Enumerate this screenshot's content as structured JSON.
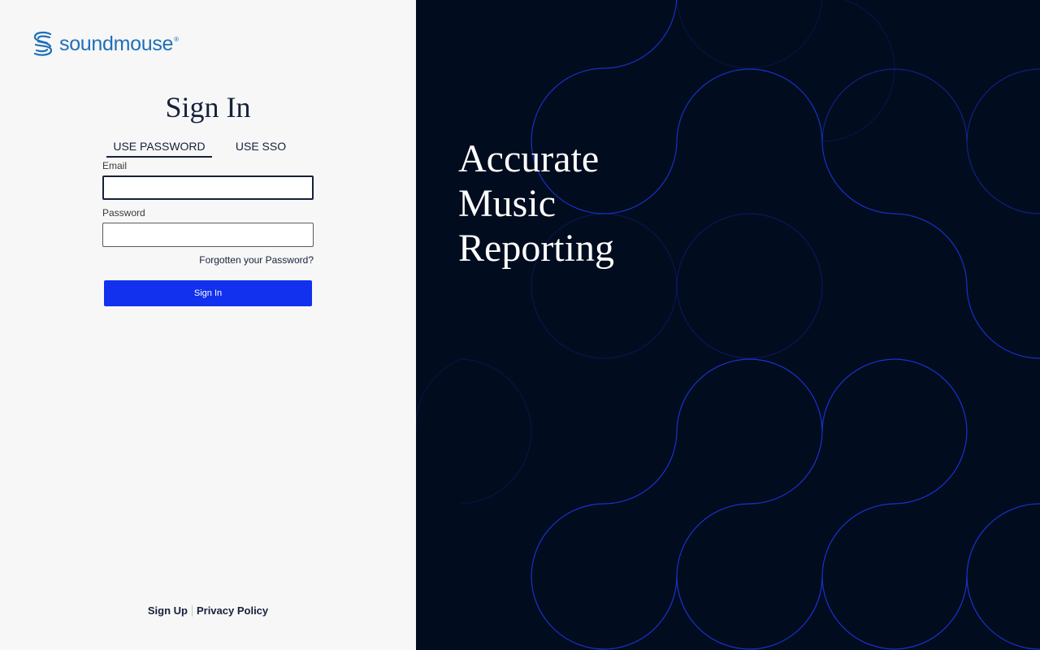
{
  "brand": {
    "name": "soundmouse",
    "registered_mark": "®",
    "color": "#1f6fb9"
  },
  "signin": {
    "title": "Sign In",
    "tabs": [
      {
        "label": "USE PASSWORD",
        "active": true
      },
      {
        "label": "USE SSO",
        "active": false
      }
    ],
    "email": {
      "label": "Email",
      "value": "",
      "placeholder": ""
    },
    "password": {
      "label": "Password",
      "value": "",
      "placeholder": ""
    },
    "forgot_link": "Forgotten your Password?",
    "submit_label": "Sign In",
    "submit_color": "#1131ee"
  },
  "footer": {
    "sign_up": "Sign Up",
    "privacy_policy": "Privacy Policy"
  },
  "hero": {
    "tagline_lines": [
      "Accurate",
      "Music",
      "Reporting"
    ],
    "background_color": "#020c1f",
    "pattern_color": "#1a35d6"
  }
}
